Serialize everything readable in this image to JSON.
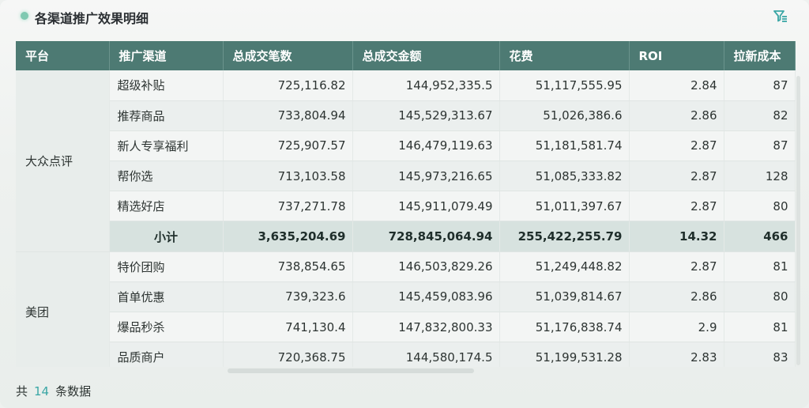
{
  "header": {
    "title": "各渠道推广效果明细",
    "filter_icon": "filter-icon",
    "accent": "#3aa6a5"
  },
  "table": {
    "columns": [
      "平台",
      "推广渠道",
      "总成交笔数",
      "总成交金额",
      "花费",
      "ROI",
      "拉新成本"
    ],
    "groups": [
      {
        "platform": "大众点评",
        "rows": [
          [
            "超级补贴",
            "725,116.82",
            "144,952,335.5",
            "51,117,555.95",
            "2.84",
            "87"
          ],
          [
            "推荐商品",
            "733,804.94",
            "145,529,313.67",
            "51,026,386.6",
            "2.86",
            "82"
          ],
          [
            "新人专享福利",
            "725,907.57",
            "146,479,119.63",
            "51,181,581.74",
            "2.87",
            "87"
          ],
          [
            "帮你选",
            "713,103.58",
            "145,973,216.65",
            "51,085,333.82",
            "2.87",
            "128"
          ],
          [
            "精选好店",
            "737,271.78",
            "145,911,079.49",
            "51,011,397.67",
            "2.87",
            "80"
          ]
        ],
        "subtotal": [
          "小计",
          "3,635,204.69",
          "728,845,064.94",
          "255,422,255.79",
          "14.32",
          "466"
        ]
      },
      {
        "platform": "美团",
        "rows": [
          [
            "特价团购",
            "738,854.65",
            "146,503,829.26",
            "51,249,448.82",
            "2.87",
            "81"
          ],
          [
            "首单优惠",
            "739,323.6",
            "145,459,083.96",
            "51,039,814.67",
            "2.86",
            "80"
          ],
          [
            "爆品秒杀",
            "741,130.4",
            "147,832,800.33",
            "51,176,838.74",
            "2.9",
            "81"
          ],
          [
            "品质商户",
            "720,368.75",
            "144,580,174.5",
            "51,199,531.28",
            "2.83",
            "83"
          ]
        ]
      }
    ]
  },
  "footer": {
    "prefix": "共",
    "count": "14",
    "suffix": "条数据"
  },
  "colors": {
    "header_bg": "#4d7a73",
    "subtotal_bg": "#d7e2df"
  }
}
